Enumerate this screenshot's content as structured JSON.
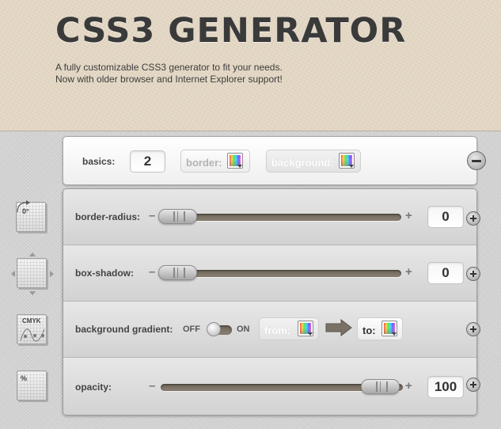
{
  "header": {
    "title": "CSS3 GENERATOR",
    "tagline_line1": "A fully customizable CSS3 generator to fit your needs.",
    "tagline_line2": "Now with older browser and Internet Explorer support!"
  },
  "basics": {
    "label": "basics:",
    "count_value": "2",
    "border_label": "border:",
    "background_label": "background:"
  },
  "rows": {
    "border_radius": {
      "label": "border-radius:",
      "minus": "–",
      "plus": "+",
      "value": "0",
      "slider_fraction": 0.0
    },
    "box_shadow": {
      "label": "box-shadow:",
      "minus": "–",
      "plus": "+",
      "value": "0",
      "slider_fraction": 0.0
    },
    "background_gradient": {
      "label": "background gradient:",
      "off_label": "OFF",
      "on_label": "ON",
      "toggle_state": "off",
      "from_label": "from:",
      "to_label": "to:"
    },
    "opacity": {
      "label": "opacity:",
      "minus": "–",
      "plus": "+",
      "value": "100",
      "slider_fraction": 1.0
    }
  },
  "side_icons": {
    "rotation_text": "0°",
    "cmyk_text": "CMYK",
    "percent_text": "%"
  },
  "icons": [
    "color-picker-icon",
    "collapse-minus-icon",
    "add-plus-icon",
    "rotation-icon",
    "shadow-move-icon",
    "cmyk-gradient-icon",
    "opacity-percent-icon",
    "gradient-arrow-icon"
  ],
  "colors": {
    "header_bg": "#e2d6c3",
    "title": "#3a3a3a",
    "slider_track": "#7a7165",
    "page_bg": "#d3d3d3"
  }
}
